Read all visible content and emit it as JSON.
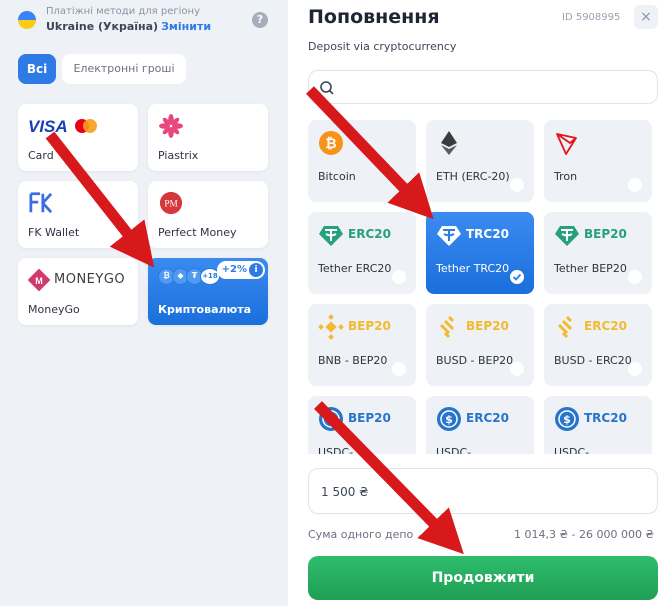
{
  "region": {
    "label": "Платіжні методи для регіону",
    "value": "Ukraine (Україна)",
    "change": "Змінити",
    "help": "?"
  },
  "filters": {
    "all": "Всі",
    "emoney": "Електронні гроші"
  },
  "methods": [
    {
      "name": "Card",
      "logo": "visa-mastercard"
    },
    {
      "name": "Piastrix",
      "logo": "piastrix"
    },
    {
      "name": "FK Wallet",
      "logo": "fk"
    },
    {
      "name": "Perfect Money",
      "logo": "pm"
    },
    {
      "name": "MoneyGo",
      "logo": "moneygo",
      "logo_text": "MONEYGO"
    },
    {
      "name": "Криптовалюта",
      "selected": true,
      "bonus": "+2%",
      "more": "+18"
    }
  ],
  "panel": {
    "title": "Поповнення",
    "subtitle": "Deposit via cryptocurrency",
    "id": "ID 5908995",
    "close": "×",
    "search_placeholder": ""
  },
  "cryptos": [
    {
      "name": "Bitcoin",
      "icon": "bitcoin-icon",
      "badge": "",
      "color": "#f7931a"
    },
    {
      "name": "ETH (ERC-20)",
      "icon": "ethereum-icon",
      "badge": "",
      "color": "#3c3c3d"
    },
    {
      "name": "Tron",
      "icon": "tron-icon",
      "badge": "",
      "color": "#e5141c"
    },
    {
      "name": "Tether ERC20",
      "icon": "tether-icon",
      "badge": "ERC20",
      "color": "#26a17b"
    },
    {
      "name": "Tether TRC20",
      "icon": "tether-icon",
      "badge": "TRC20",
      "color": "#26a17b",
      "selected": true
    },
    {
      "name": "Tether BEP20",
      "icon": "tether-icon",
      "badge": "BEP20",
      "color": "#26a17b"
    },
    {
      "name": "BNB - BEP20",
      "icon": "bnb-icon",
      "badge": "BEP20",
      "color": "#f3ba2f"
    },
    {
      "name": "BUSD - BEP20",
      "icon": "busd-icon",
      "badge": "BEP20",
      "color": "#f3ba2f"
    },
    {
      "name": "BUSD - ERC20",
      "icon": "busd-icon",
      "badge": "ERC20",
      "color": "#f3ba2f"
    },
    {
      "name": "USDC-",
      "icon": "usdc-icon",
      "badge": "BEP20",
      "color": "#2775ca"
    },
    {
      "name": "USDC-",
      "icon": "usdc-icon",
      "badge": "ERC20",
      "color": "#2775ca"
    },
    {
      "name": "USDC-",
      "icon": "usdc-icon",
      "badge": "TRC20",
      "color": "#2775ca"
    }
  ],
  "amount": {
    "value": "1 500 ₴"
  },
  "range": {
    "label": "Сума одного депо",
    "value": "1 014,3 ₴ - 26 000 000 ₴"
  },
  "continue_label": "Продовжити",
  "colors": {
    "accent": "#2f7be5",
    "success": "#22ad5c",
    "arrow": "#d7191c"
  }
}
